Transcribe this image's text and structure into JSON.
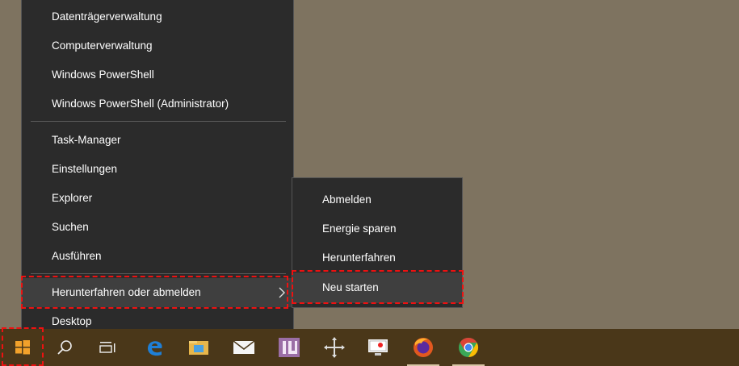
{
  "context_menu": {
    "items": [
      {
        "label": "Datenträgerverwaltung"
      },
      {
        "label": "Computerverwaltung"
      },
      {
        "label": "Windows PowerShell"
      },
      {
        "label": "Windows PowerShell (Administrator)"
      },
      {
        "label": "Task-Manager"
      },
      {
        "label": "Einstellungen"
      },
      {
        "label": "Explorer"
      },
      {
        "label": "Suchen"
      },
      {
        "label": "Ausführen"
      },
      {
        "label": "Herunterfahren oder abmelden"
      },
      {
        "label": "Desktop"
      }
    ]
  },
  "submenu": {
    "items": [
      {
        "label": "Abmelden"
      },
      {
        "label": "Energie sparen"
      },
      {
        "label": "Herunterfahren"
      },
      {
        "label": "Neu starten"
      }
    ]
  },
  "taskbar": {
    "icons": [
      "windows-start-icon",
      "search-icon",
      "task-view-icon",
      "edge-icon",
      "file-explorer-icon",
      "mail-icon",
      "app-icon",
      "move-icon",
      "screenshot-tool-icon",
      "firefox-icon",
      "chrome-icon"
    ]
  },
  "colors": {
    "desktop": "#7e7360",
    "menu_bg": "#2b2b2b",
    "highlight_outline": "#e11111",
    "taskbar": "#4a3719"
  }
}
